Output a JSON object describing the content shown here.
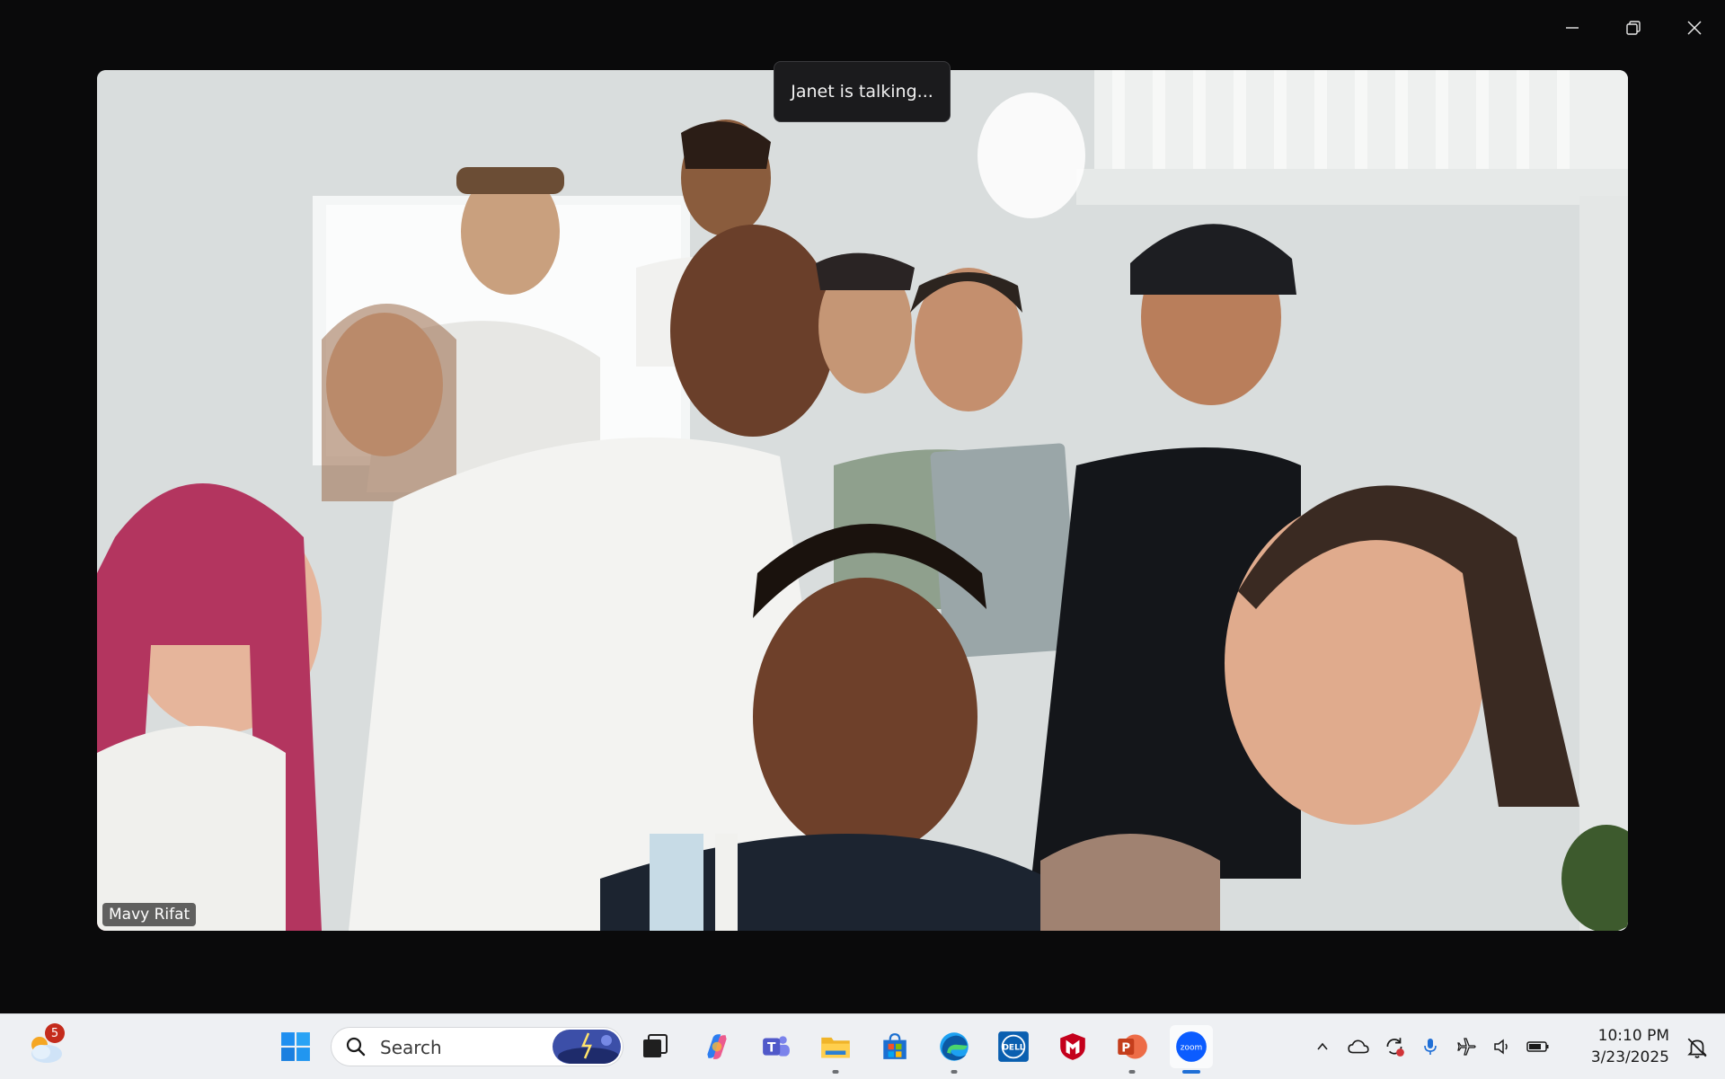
{
  "window": {
    "controls": [
      "minimize",
      "restore",
      "close"
    ]
  },
  "meeting": {
    "active_speaker_toast": "Janet is talking...",
    "participant_name": "Mavy Rifat"
  },
  "taskbar": {
    "weather_badge": "5",
    "search_placeholder": "Search",
    "apps": [
      {
        "name": "start-icon"
      },
      {
        "name": "task-view-icon"
      },
      {
        "name": "copilot-icon"
      },
      {
        "name": "teams-icon"
      },
      {
        "name": "file-explorer-icon"
      },
      {
        "name": "microsoft-store-icon"
      },
      {
        "name": "edge-icon"
      },
      {
        "name": "dell-icon"
      },
      {
        "name": "mcafee-icon"
      },
      {
        "name": "powerpoint-icon"
      },
      {
        "name": "zoom-icon",
        "label": "zoom"
      }
    ],
    "clock_time": "10:10 PM",
    "clock_date": "3/23/2025",
    "colors": {
      "accent": "#1f6fd6",
      "zoom_blue": "#0b5cff",
      "badge_red": "#c42b1c"
    }
  }
}
